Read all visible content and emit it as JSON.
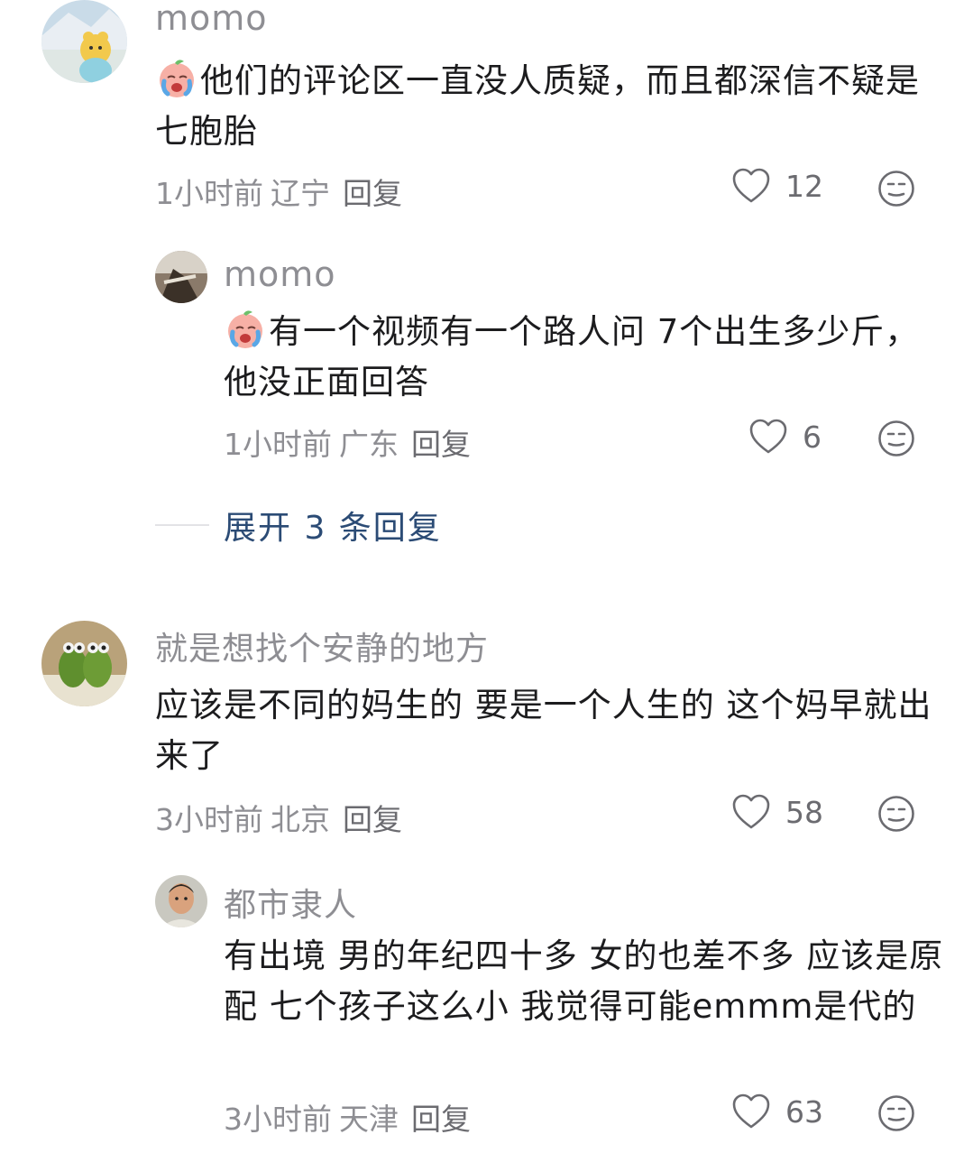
{
  "comments": [
    {
      "username": "momo",
      "text": "他们的评论区一直没人质疑，而且都深信不疑是七胞胎",
      "time": "1小时前",
      "location": "辽宁",
      "reply_label": "回复",
      "likes": "12",
      "emoji": "crying-peach-emoji"
    },
    {
      "username": "momo",
      "text": "有一个视频有一个路人问 7个出生多少斤，他没正面回答",
      "time": "1小时前",
      "location": "广东",
      "reply_label": "回复",
      "likes": "6",
      "emoji": "crying-peach-emoji"
    },
    {
      "username": "就是想找个安静的地方",
      "text": "应该是不同的妈生的 要是一个人生的 这个妈早就出来了",
      "time": "3小时前",
      "location": "北京",
      "reply_label": "回复",
      "likes": "58"
    },
    {
      "username": "都市隶人",
      "text": "有出境 男的年纪四十多 女的也差不多 应该是原配 七个孩子这么小 我觉得可能emmm是代的",
      "time": "3小时前",
      "location": "天津",
      "reply_label": "回复",
      "likes": "63"
    }
  ],
  "expand_replies": "展开 3 条回复",
  "colors": {
    "text": "#1c1c1e",
    "meta": "#8e8e93",
    "expand": "#2b4b75"
  }
}
